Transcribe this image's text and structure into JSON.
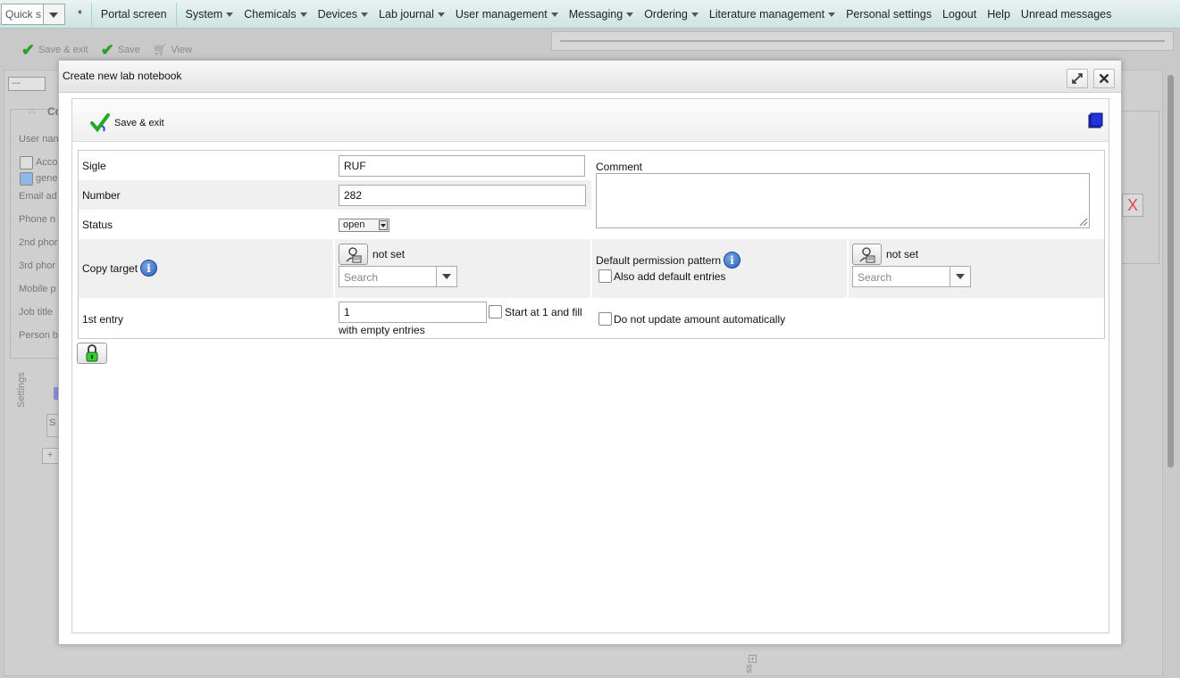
{
  "menubar": {
    "quick_search": "Quick s",
    "star": "*",
    "items": [
      {
        "label": "Portal screen",
        "dropdown": false
      },
      {
        "label": "System",
        "dropdown": true
      },
      {
        "label": "Chemicals",
        "dropdown": true
      },
      {
        "label": "Devices",
        "dropdown": true
      },
      {
        "label": "Lab journal",
        "dropdown": true
      },
      {
        "label": "User management",
        "dropdown": true
      },
      {
        "label": "Messaging",
        "dropdown": true
      },
      {
        "label": "Ordering",
        "dropdown": true
      },
      {
        "label": "Literature management",
        "dropdown": true
      },
      {
        "label": "Personal settings",
        "dropdown": false
      },
      {
        "label": "Logout",
        "dropdown": false
      },
      {
        "label": "Help",
        "dropdown": false
      },
      {
        "label": "Unread messages",
        "dropdown": false
      }
    ]
  },
  "background": {
    "toolbar": {
      "save_exit": "Save & exit",
      "save": "Save",
      "view": "View"
    },
    "select_value": "---",
    "panel_title": "Co",
    "fields": [
      "User nan",
      "Acco",
      "gene",
      "Email ad",
      "Phone n",
      "2nd phon",
      "3rd phor",
      "Mobile p",
      "Job title",
      "Person b"
    ],
    "settings_label": "Settings",
    "settings_button": "S",
    "add_button": "+",
    "bottom_tab": "ss",
    "close_mark": "X"
  },
  "dialog": {
    "title": "Create new lab notebook",
    "toolbar": {
      "save_exit": "Save & exit"
    },
    "form": {
      "sigle_label": "Sigle",
      "sigle_value": "RUF",
      "number_label": "Number",
      "number_value": "282",
      "status_label": "Status",
      "status_value": "open",
      "comment_label": "Comment",
      "comment_value": "",
      "copy_target_label": "Copy target",
      "copy_target_value": "not set",
      "copy_target_search_placeholder": "Search",
      "default_permission_label": "Default permission pattern",
      "default_permission_value": "not set",
      "default_permission_search_placeholder": "Search",
      "also_add_default_label": "Also add default entries",
      "first_entry_label": "1st entry",
      "first_entry_value": "1",
      "start_at_1_label": "Start at 1 and fill",
      "start_at_1_label_cont": "with empty entries",
      "do_not_update_label": "Do not update amount automatically"
    }
  },
  "colors": {
    "menubar": "#d7e8e6",
    "check_green": "#22aa22",
    "info_blue": "#2a5fb3",
    "book_blue": "#1d2fc4"
  }
}
